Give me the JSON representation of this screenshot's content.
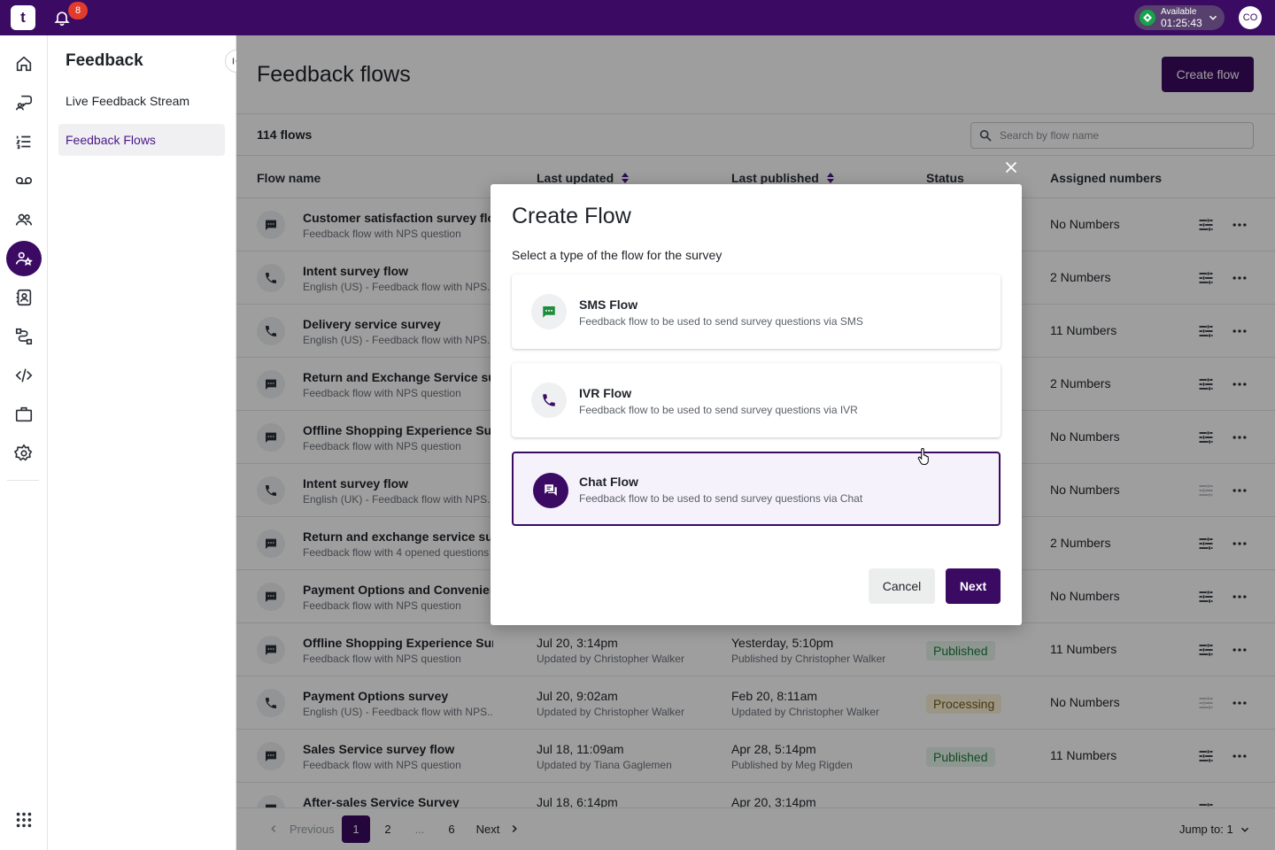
{
  "topbar": {
    "logo": "t",
    "notifications_count": "8",
    "status_label": "Available",
    "status_time": "01:25:43",
    "avatar_initials": "CO"
  },
  "sidepanel": {
    "title": "Feedback",
    "items": [
      {
        "label": "Live Feedback Stream"
      },
      {
        "label": "Feedback Flows"
      }
    ]
  },
  "main": {
    "title": "Feedback flows",
    "create_label": "Create flow",
    "count_label": "114 flows",
    "search_placeholder": "Search by flow name",
    "columns": {
      "name": "Flow name",
      "updated": "Last updated",
      "published": "Last published",
      "status": "Status",
      "numbers": "Assigned numbers"
    },
    "rows": [
      {
        "type": "sms",
        "name": "Customer satisfaction survey flow",
        "desc": "Feedback flow with NPS question",
        "updated": "",
        "updated_by": "",
        "published": "",
        "published_by": "",
        "status": "",
        "numbers": "No Numbers"
      },
      {
        "type": "ivr",
        "name": "Intent survey flow",
        "desc": "English (US) - Feedback flow with NPS...",
        "updated": "",
        "updated_by": "",
        "published": "",
        "published_by": "",
        "status": "",
        "numbers": "2 Numbers"
      },
      {
        "type": "ivr",
        "name": "Delivery service survey",
        "desc": "English (US) - Feedback flow with NPS...",
        "updated": "",
        "updated_by": "",
        "published": "",
        "published_by": "",
        "status": "",
        "numbers": "11 Numbers"
      },
      {
        "type": "sms",
        "name": "Return and Exchange Service survey",
        "desc": "Feedback flow with NPS question",
        "updated": "",
        "updated_by": "",
        "published": "",
        "published_by": "",
        "status": "",
        "numbers": "2 Numbers"
      },
      {
        "type": "sms",
        "name": "Offline Shopping Experience Survey",
        "desc": "Feedback flow with NPS question",
        "updated": "",
        "updated_by": "",
        "published": "",
        "published_by": "",
        "status": "",
        "numbers": "No Numbers"
      },
      {
        "type": "ivr",
        "name": "Intent survey flow",
        "desc": "English (UK) - Feedback flow with NPS...",
        "updated": "",
        "updated_by": "",
        "published": "",
        "published_by": "",
        "status": "",
        "numbers": "No Numbers"
      },
      {
        "type": "sms",
        "name": "Return and exchange service survey",
        "desc": "Feedback flow with 4 opened questions",
        "updated": "",
        "updated_by": "",
        "published": "",
        "published_by": "",
        "status": "",
        "numbers": "2 Numbers"
      },
      {
        "type": "sms",
        "name": "Payment Options and Convenience",
        "desc": "Feedback flow with NPS question",
        "updated": "",
        "updated_by": "",
        "published": "",
        "published_by": "",
        "status": "",
        "numbers": "No Numbers"
      },
      {
        "type": "sms",
        "name": "Offline Shopping Experience Survey",
        "desc": "Feedback flow with NPS question",
        "updated": "Jul 20, 3:14pm",
        "updated_by": "Updated by Christopher Walker",
        "published": "Yesterday, 5:10pm",
        "published_by": "Published by Christopher Walker",
        "status": "Published",
        "numbers": "11 Numbers"
      },
      {
        "type": "ivr",
        "name": "Payment Options survey",
        "desc": "English (US) - Feedback flow with NPS...",
        "updated": "Jul 20, 9:02am",
        "updated_by": "Updated by Christopher Walker",
        "published": "Feb 20, 8:11am",
        "published_by": "Updated by Christopher Walker",
        "status": "Processing",
        "numbers": "No Numbers"
      },
      {
        "type": "sms",
        "name": "Sales Service survey flow",
        "desc": "Feedback flow with NPS question",
        "updated": "Jul 18, 11:09am",
        "updated_by": "Updated by Tiana Gaglemen",
        "published": "Apr 28, 5:14pm",
        "published_by": "Published by Meg Rigden",
        "status": "Published",
        "numbers": "11 Numbers"
      },
      {
        "type": "sms",
        "name": "After-sales Service Survey",
        "desc": "",
        "updated": "Jul 18, 6:14pm",
        "updated_by": "",
        "published": "Apr 20, 3:14pm",
        "published_by": "",
        "status": "",
        "numbers": ""
      }
    ],
    "pager": {
      "previous": "Previous",
      "pages": [
        "1",
        "2",
        "...",
        "6"
      ],
      "next": "Next",
      "jump_label": "Jump to: 1"
    }
  },
  "dialog": {
    "title": "Create Flow",
    "subtitle": "Select a type of the flow for the survey",
    "options": [
      {
        "title": "SMS Flow",
        "desc": "Feedback flow to be used to send survey questions via SMS"
      },
      {
        "title": "IVR Flow",
        "desc": "Feedback flow to be used to send survey questions via IVR"
      },
      {
        "title": "Chat Flow",
        "desc": "Feedback flow to be used to send survey questions via Chat"
      }
    ],
    "cancel_label": "Cancel",
    "next_label": "Next",
    "selected_option": "Chat Flow"
  },
  "colors": {
    "brand": "#3b0a63",
    "badge_red": "#e03b2c",
    "available_green": "#17a34a",
    "sms_icon_green": "#1e8e3e",
    "ivr_icon_purple": "#3b0a63"
  }
}
